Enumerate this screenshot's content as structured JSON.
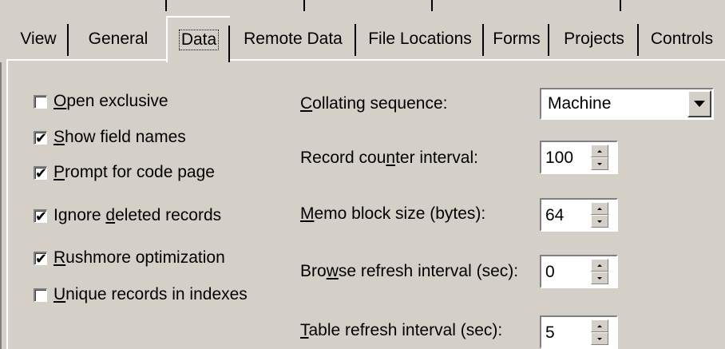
{
  "tabs": [
    {
      "label": "View"
    },
    {
      "label": "General"
    },
    {
      "label": "Data"
    },
    {
      "label": "Remote Data"
    },
    {
      "label": "File Locations"
    },
    {
      "label": "Forms"
    },
    {
      "label": "Projects"
    },
    {
      "label": "Controls"
    }
  ],
  "active_tab": "Data",
  "options": {
    "open_exclusive": {
      "checked": false,
      "hotkey": "O",
      "rest": "pen exclusive"
    },
    "show_field_names": {
      "checked": true,
      "hotkey": "S",
      "rest": "how field names"
    },
    "prompt_code_page": {
      "checked": true,
      "hotkey": "P",
      "rest": "rompt for code page"
    },
    "ignore_deleted": {
      "checked": true,
      "pre": "Ignore ",
      "hotkey": "d",
      "rest": "eleted records"
    },
    "rushmore": {
      "checked": true,
      "hotkey": "R",
      "rest": "ushmore optimization"
    },
    "unique_records": {
      "checked": false,
      "hotkey": "U",
      "rest": "nique records in indexes"
    }
  },
  "fields": {
    "collating": {
      "hotkey": "C",
      "rest": "ollating sequence:",
      "value": "Machine"
    },
    "record_counter": {
      "pre": "Record cou",
      "hotkey": "n",
      "rest": "ter interval:",
      "value": "100"
    },
    "memo_block": {
      "hotkey": "M",
      "rest": "emo block size (bytes):",
      "value": "64"
    },
    "browse_refresh": {
      "pre": "Bro",
      "hotkey": "w",
      "rest": "se refresh interval (sec):",
      "value": "0"
    },
    "table_refresh": {
      "hotkey": "T",
      "rest": "able refresh interval (sec):",
      "value": "5"
    }
  },
  "check_glyph": "✔",
  "colors": {
    "face": "#d4d0c8",
    "shadow": "#808080",
    "highlight": "#ffffff"
  }
}
